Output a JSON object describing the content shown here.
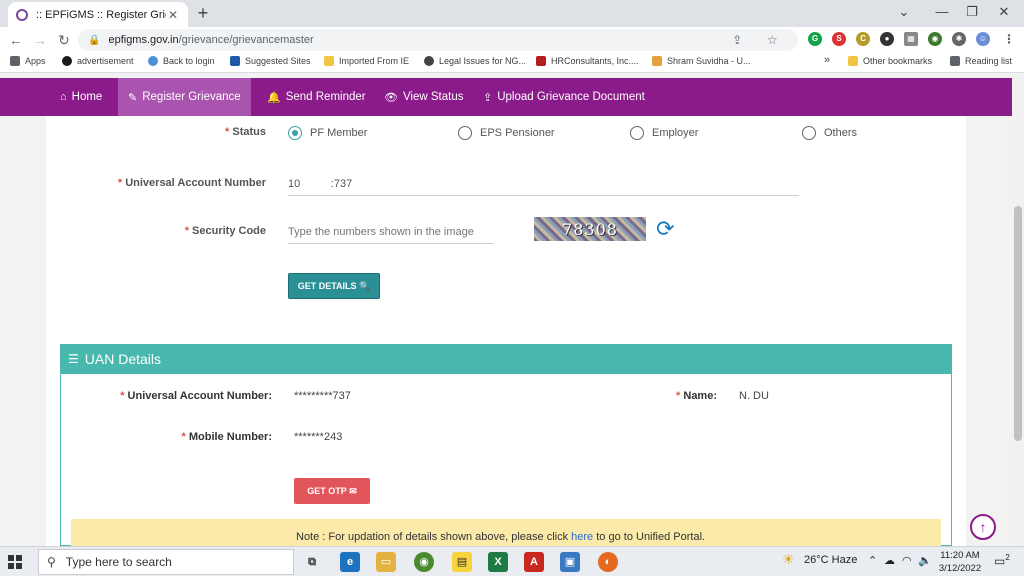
{
  "browser": {
    "tab_title": ":: EPFiGMS :: Register Grievance",
    "tab_close": "✕",
    "new_tab": "+",
    "url_domain": "epfigms.gov.in",
    "url_path": "/grievance/grievancemaster",
    "window_controls": [
      "⌄",
      "—",
      "❐",
      "✕"
    ]
  },
  "bookmarks": [
    {
      "label": "Apps",
      "color": "#5f6368"
    },
    {
      "label": "advertisement",
      "color": "#1a1a1a"
    },
    {
      "label": "Back to login",
      "color": "#4a90d9"
    },
    {
      "label": "Suggested Sites",
      "color": "#1e5aa8"
    },
    {
      "label": "Imported From IE",
      "color": "#f4c542"
    },
    {
      "label": "Legal Issues for NG...",
      "color": "#444444"
    },
    {
      "label": "HRConsultants, Inc....",
      "color": "#b01e1e"
    },
    {
      "label": "Shram Suvidha - U...",
      "color": "#e5a13b"
    }
  ],
  "bookmarks_more": "»",
  "bookmarks_right": [
    {
      "label": "Other bookmarks",
      "color": "#f4c542"
    },
    {
      "label": "Reading list",
      "color": "#5f6368"
    }
  ],
  "nav": [
    {
      "label": "Home",
      "icon": "⌂"
    },
    {
      "label": "Register Grievance",
      "icon": "✎"
    },
    {
      "label": "Send Reminder",
      "icon": "🔔"
    },
    {
      "label": "View Status",
      "icon": "👁"
    },
    {
      "label": "Upload Grievance Document",
      "icon": "⇪"
    }
  ],
  "form": {
    "status_label": "Status",
    "status_options": [
      "PF Member",
      "EPS Pensioner",
      "Employer",
      "Others"
    ],
    "status_selected": "PF Member",
    "uan_label": "Universal Account Number",
    "uan_value": "10          :737",
    "security_label": "Security Code",
    "security_placeholder": "Type the numbers shown in the image",
    "captcha_text": "78308",
    "get_details": "GET DETAILS",
    "required_mark": "*"
  },
  "uan_details": {
    "title": "UAN Details",
    "uan_label": "Universal Account Number:",
    "uan_value": "*********737",
    "name_label": "Name:",
    "name_value": "N.           DU",
    "mobile_label": "Mobile Number:",
    "mobile_value": "*******243",
    "get_otp": "GET OTP",
    "note_before": "Note : For updation of details shown above, please click ",
    "note_link": "here",
    "note_after": " to go to Unified Portal."
  },
  "taskbar": {
    "search_placeholder": "Type here to search",
    "weather": "26°C  Haze",
    "time": "11:20 AM",
    "date": "3/12/2022",
    "notification_count": "2"
  },
  "colors": {
    "site_nav": "#8b1a8b",
    "panel_teal": "#48b8ae",
    "button_teal": "#2b8f96",
    "button_red": "#e2555a",
    "note_bg": "#fbeaaa"
  }
}
